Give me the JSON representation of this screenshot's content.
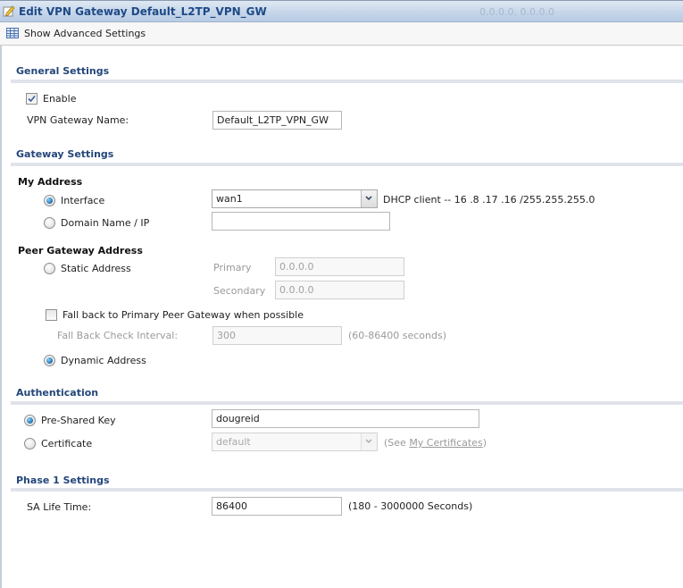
{
  "window": {
    "title": "Edit VPN Gateway Default_L2TP_VPN_GW",
    "ghost_text": "0.0.0.0, 0.0.0.0"
  },
  "toolbar": {
    "show_advanced_label": "Show Advanced Settings"
  },
  "general": {
    "title": "General Settings",
    "enable_label": "Enable",
    "enable_checked": true,
    "name_label": "VPN Gateway Name:",
    "name_value": "Default_L2TP_VPN_GW"
  },
  "gateway": {
    "title": "Gateway Settings",
    "my_address": {
      "heading": "My Address",
      "interface_label": "Interface",
      "interface_selected": true,
      "interface_value": "wan1",
      "interface_info": "DHCP client -- 16  .8  .17  .16  /255.255.255.0",
      "domain_label": "Domain Name / IP",
      "domain_value": ""
    },
    "peer": {
      "heading": "Peer Gateway Address",
      "static_label": "Static Address",
      "primary_label": "Primary",
      "primary_value": "0.0.0.0",
      "secondary_label": "Secondary",
      "secondary_value": "0.0.0.0",
      "fallback_label": "Fall back to Primary Peer Gateway when possible",
      "fallback_checked": false,
      "fallback_interval_label": "Fall Back Check Interval:",
      "fallback_interval_value": "300",
      "fallback_interval_hint": "(60-86400 seconds)",
      "dynamic_label": "Dynamic Address",
      "dynamic_selected": true
    }
  },
  "auth": {
    "title": "Authentication",
    "psk_label": "Pre-Shared Key",
    "psk_selected": true,
    "psk_value": "dougreid",
    "cert_label": "Certificate",
    "cert_value": "default",
    "cert_hint_prefix": "(See ",
    "cert_hint_link": "My Certificates",
    "cert_hint_suffix": ")"
  },
  "phase1": {
    "title": "Phase 1 Settings",
    "sa_label": "SA Life Time:",
    "sa_value": "86400",
    "sa_hint": "(180 - 3000000 Seconds)"
  }
}
